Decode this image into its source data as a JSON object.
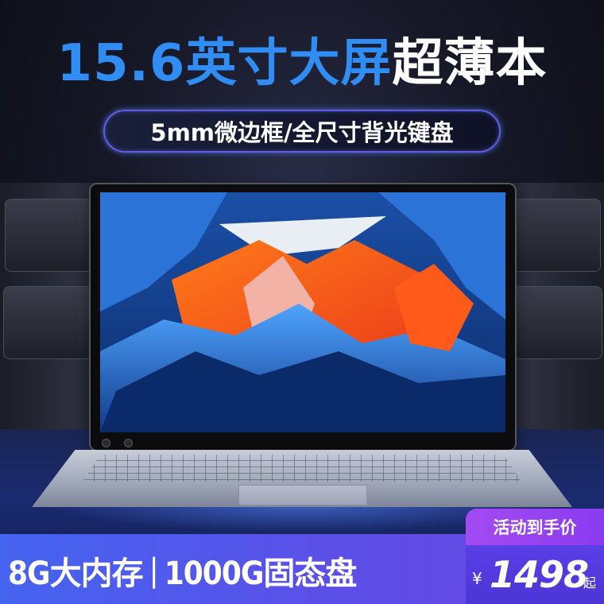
{
  "headline": {
    "size_text": "15.6",
    "screen_text": "英寸大屏",
    "thin_text": "超薄本"
  },
  "subtitle": "5mm微边框/全尺寸背光键盘",
  "banner": {
    "memory": "8G大内存",
    "separator": "|",
    "storage": "1000G固态盘"
  },
  "price": {
    "tag": "活动到手价",
    "currency": "¥",
    "value": "1498",
    "suffix": "起"
  },
  "colors": {
    "headline_blue": "#2f8df4",
    "banner_blue": "#4564f0",
    "price_purple": "#8a3bef"
  }
}
